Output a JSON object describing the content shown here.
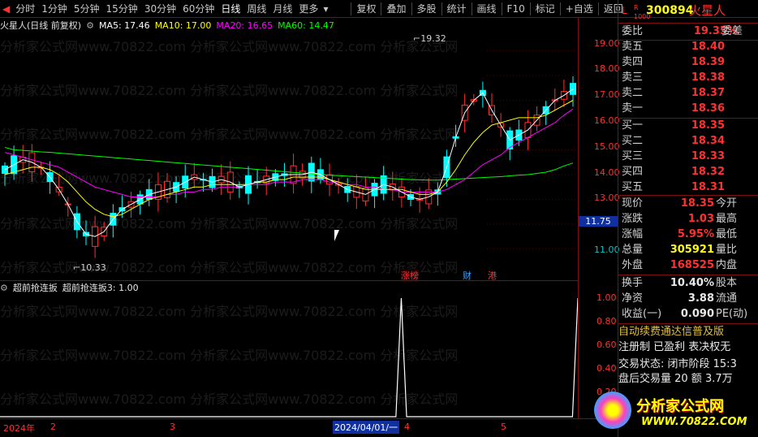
{
  "toolbar": {
    "period_toggle": "◀",
    "items": [
      "分时",
      "1分钟",
      "5分钟",
      "15分钟",
      "30分钟",
      "60分钟",
      "日线",
      "周线",
      "月线",
      "更多"
    ],
    "active": "日线",
    "more_icon": "▾",
    "right_items": [
      "复权",
      "叠加",
      "多股",
      "统计",
      "画线",
      "F10",
      "标记",
      "+自选",
      "返回"
    ]
  },
  "legend": {
    "stock": "火星人(日线 前复权)",
    "ma5": "MA5: 17.46",
    "ma10": "MA10: 17.00",
    "ma20": "MA20: 16.65",
    "ma60": "MA60: 14.47"
  },
  "indicator": {
    "name": "超前抢连扳",
    "value": "超前抢连扳3: 1.00",
    "ticks": [
      "1.00",
      "0.80",
      "0.60",
      "0.40",
      "0.20"
    ],
    "values": [
      0,
      0,
      0,
      0,
      0,
      0,
      0,
      0,
      0,
      0,
      0,
      0,
      0,
      0,
      0,
      0,
      0,
      0,
      0,
      0,
      0,
      0,
      0,
      0,
      0,
      0,
      0,
      0,
      0,
      0,
      0,
      0,
      0,
      0,
      0,
      0,
      0,
      0,
      0,
      0,
      0,
      0,
      0,
      0,
      0,
      0,
      0,
      0,
      0,
      0,
      0,
      0,
      0,
      0,
      0,
      0,
      0,
      0,
      0,
      0,
      0,
      0,
      0,
      0,
      0,
      0,
      0,
      0,
      0,
      0,
      0,
      0,
      0,
      0,
      0,
      1,
      0,
      0,
      0,
      0,
      0,
      0,
      0,
      0,
      0,
      0,
      0,
      0,
      0,
      0,
      0,
      0,
      0,
      0,
      0,
      0,
      0,
      0,
      0,
      0,
      0,
      0,
      0,
      0,
      0,
      0,
      0,
      0,
      1
    ]
  },
  "main_axis": {
    "ticks": [
      "19.00",
      "18.00",
      "17.00",
      "16.00",
      "15.00",
      "14.00",
      "13.00",
      "12.00",
      "11.00"
    ],
    "cursor_price": "11.75"
  },
  "annotations": {
    "high": "19.32",
    "low": "10.33",
    "markers": [
      "涨榜",
      "财",
      "港"
    ]
  },
  "dates": [
    "2024年",
    "2",
    "3",
    "2024/04/01/一",
    "4",
    "5"
  ],
  "colors": {
    "up": "#ff3030",
    "down": "#00ffff",
    "ma5": "#ffffff",
    "ma10": "#ffff00",
    "ma20": "#ff00ff",
    "ma60": "#00ff00"
  },
  "chart_data": {
    "type": "candlestick",
    "ylim": [
      10,
      20
    ],
    "ma5": [
      14.2,
      14.4,
      14.6,
      14.5,
      14.3,
      13.9,
      13.4,
      12.8,
      12.1,
      11.6,
      11.5,
      11.7,
      12.2,
      12.6,
      12.8,
      13.0,
      13.2,
      13.3,
      13.4,
      13.5,
      13.7,
      13.9,
      13.8,
      13.7,
      13.8,
      13.7,
      13.5,
      13.6,
      13.7,
      13.8,
      13.9,
      14.0,
      14.0,
      14.0,
      14.1,
      14.0,
      13.8,
      13.6,
      13.4,
      13.3,
      13.2,
      13.4,
      13.6,
      13.5,
      13.3,
      13.1,
      13.0,
      13.1,
      13.3,
      14.3,
      15.5,
      16.5,
      17.0,
      17.3,
      16.6,
      16.0,
      15.4,
      15.6,
      15.8,
      16.2,
      16.6,
      17.0,
      17.2,
      17.46
    ],
    "ma10": [
      14.0,
      14.1,
      14.2,
      14.3,
      14.3,
      14.2,
      14.0,
      13.7,
      13.3,
      12.9,
      12.6,
      12.4,
      12.3,
      12.4,
      12.6,
      12.8,
      13.0,
      13.1,
      13.2,
      13.3,
      13.4,
      13.5,
      13.5,
      13.6,
      13.6,
      13.6,
      13.6,
      13.6,
      13.7,
      13.7,
      13.8,
      13.8,
      13.9,
      13.9,
      13.9,
      13.9,
      13.8,
      13.7,
      13.6,
      13.5,
      13.4,
      13.4,
      13.4,
      13.4,
      13.4,
      13.3,
      13.2,
      13.2,
      13.3,
      13.7,
      14.2,
      14.8,
      15.3,
      15.7,
      16.0,
      16.1,
      16.2,
      16.3,
      16.3,
      16.3,
      16.4,
      16.6,
      16.8,
      17.0
    ],
    "ma20": [
      14.9,
      14.8,
      14.7,
      14.6,
      14.5,
      14.4,
      14.3,
      14.1,
      13.9,
      13.7,
      13.5,
      13.4,
      13.3,
      13.2,
      13.1,
      13.1,
      13.1,
      13.1,
      13.2,
      13.2,
      13.3,
      13.3,
      13.4,
      13.4,
      13.5,
      13.5,
      13.5,
      13.6,
      13.6,
      13.6,
      13.7,
      13.7,
      13.7,
      13.8,
      13.8,
      13.8,
      13.7,
      13.7,
      13.6,
      13.6,
      13.5,
      13.5,
      13.4,
      13.4,
      13.3,
      13.3,
      13.3,
      13.3,
      13.3,
      13.4,
      13.6,
      13.8,
      14.1,
      14.4,
      14.6,
      14.8,
      15.1,
      15.3,
      15.5,
      15.7,
      15.9,
      16.1,
      16.4,
      16.65
    ],
    "ma60": [
      15.1,
      15.0,
      14.98,
      14.95,
      14.92,
      14.9,
      14.87,
      14.84,
      14.81,
      14.78,
      14.75,
      14.72,
      14.69,
      14.66,
      14.63,
      14.6,
      14.57,
      14.54,
      14.51,
      14.48,
      14.45,
      14.42,
      14.39,
      14.36,
      14.33,
      14.3,
      14.27,
      14.24,
      14.21,
      14.18,
      14.15,
      14.12,
      14.09,
      14.06,
      14.03,
      14.0,
      13.98,
      13.96,
      13.94,
      13.92,
      13.9,
      13.88,
      13.86,
      13.84,
      13.82,
      13.8,
      13.79,
      13.78,
      13.78,
      13.8,
      13.82,
      13.84,
      13.86,
      13.88,
      13.9,
      13.92,
      13.95,
      13.98,
      14.0,
      14.05,
      14.1,
      14.2,
      14.35,
      14.47
    ]
  }
}
